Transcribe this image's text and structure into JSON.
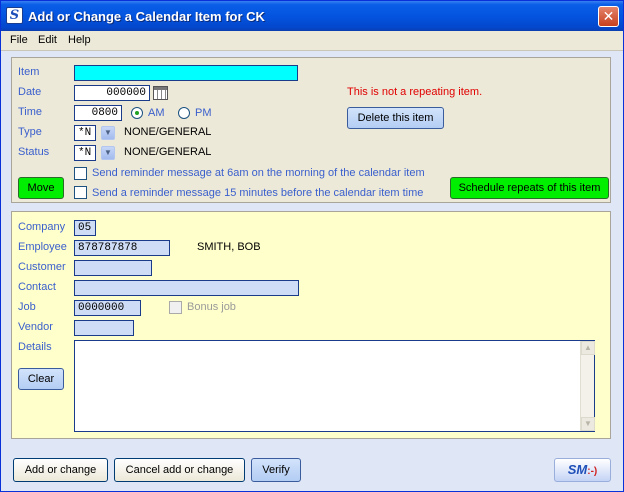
{
  "window": {
    "app_icon": "S",
    "title": "Add or Change a Calendar Item for CK",
    "close_glyph": "✕"
  },
  "menu": {
    "file": "File",
    "edit": "Edit",
    "help": "Help"
  },
  "form": {
    "item_label": "Item",
    "item_value": "",
    "date_label": "Date",
    "date_value": "000000",
    "time_label": "Time",
    "time_value": "0800",
    "am_label": "AM",
    "pm_label": "PM",
    "am_selected": true,
    "type_label": "Type",
    "type_code": "*N",
    "type_desc": "NONE/GENERAL",
    "status_label": "Status",
    "status_code": "*N",
    "status_desc": "NONE/GENERAL",
    "repeat_notice": "This is not a repeating item.",
    "delete_button": "Delete this item",
    "reminder_6am": "Send reminder message at 6am on the morning of the calendar item",
    "reminder_15min": "Send a reminder message 15 minutes before the calendar item time",
    "move_button": "Move",
    "schedule_button": "Schedule repeats of this item"
  },
  "details": {
    "company_label": "Company",
    "company_value": "05",
    "employee_label": "Employee",
    "employee_value": "878787878",
    "employee_name": "SMITH, BOB",
    "customer_label": "Customer",
    "customer_value": "",
    "contact_label": "Contact",
    "contact_value": "",
    "job_label": "Job",
    "job_value": "0000000",
    "bonus_job_label": "Bonus job",
    "vendor_label": "Vendor",
    "vendor_value": "",
    "details_label": "Details",
    "details_value": "",
    "clear_button": "Clear"
  },
  "footer": {
    "add_change_button": "Add or change",
    "cancel_button": "Cancel add or change",
    "verify_button": "Verify",
    "logo_text": "SM",
    "logo_smile": ":-)"
  },
  "colors": {
    "title_bar": "#0454e0",
    "item_field": "#00ffff",
    "label_blue": "#3a5fcd",
    "notice_red": "#e00000",
    "green_button": "#00ee00",
    "detail_panel": "#ffffcc"
  }
}
